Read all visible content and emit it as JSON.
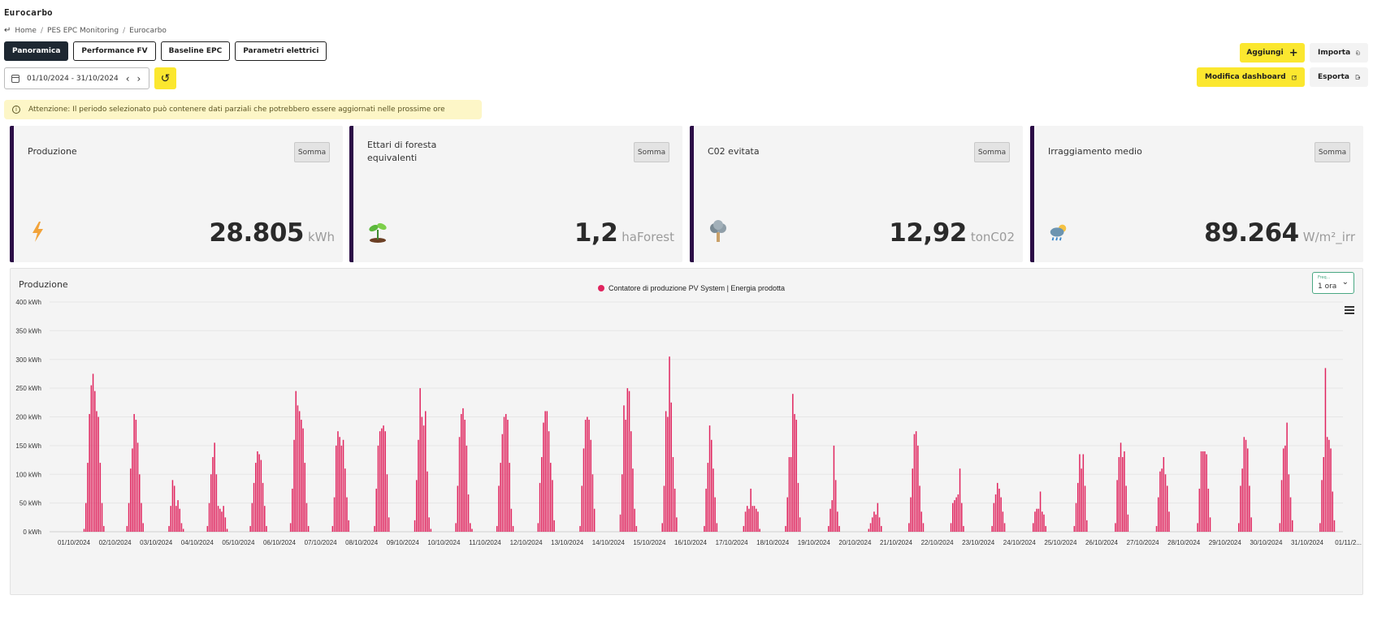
{
  "app": {
    "title": "Eurocarbo"
  },
  "breadcrumb": {
    "items": [
      "Home",
      "PES EPC Monitoring",
      "Eurocarbo"
    ]
  },
  "tabs": [
    {
      "label": "Panoramica",
      "active": true
    },
    {
      "label": "Performance FV",
      "active": false
    },
    {
      "label": "Baseline EPC",
      "active": false
    },
    {
      "label": "Parametri elettrici",
      "active": false
    }
  ],
  "toolbar": {
    "date_range": "01/10/2024 - 31/10/2024",
    "add_label": "Aggiungi",
    "import_label": "Importa",
    "edit_dashboard_label": "Modifica dashboard",
    "export_label": "Esporta"
  },
  "alert": {
    "text": "Attenzione: Il periodo selezionato può contenere dati parziali che potrebbero essere aggiornati nelle prossime ore"
  },
  "cards": [
    {
      "title": "Produzione",
      "aggregation": "Somma",
      "value": "28.805",
      "unit": "kWh",
      "icon": "lightning-icon"
    },
    {
      "title": "Ettari di foresta equivalenti",
      "aggregation": "Somma",
      "value": "1,2",
      "unit": "haForest",
      "icon": "sprout-icon"
    },
    {
      "title": "C02 evitata",
      "aggregation": "Somma",
      "value": "12,92",
      "unit": "tonC02",
      "icon": "tree-icon"
    },
    {
      "title": "Irraggiamento medio",
      "aggregation": "Somma",
      "value": "89.264",
      "unit": "W/m²_irr",
      "icon": "weather-icon"
    }
  ],
  "chart_panel": {
    "title": "Produzione",
    "frequency_label": "Freq...",
    "frequency_value": "1 ora"
  },
  "colors": {
    "accent": "#fbe72f",
    "card_border": "#2b0c46",
    "series": "#e0245e",
    "tab_active": "#1e2832"
  },
  "chart_data": {
    "type": "bar",
    "legend": "Contatore di produzione PV System | Energia prodotta",
    "ylabel_unit": "kWh",
    "ylim": [
      0,
      400
    ],
    "yticks": [
      "0 kWh",
      "50 kWh",
      "100 kWh",
      "150 kWh",
      "200 kWh",
      "250 kWh",
      "300 kWh",
      "350 kWh",
      "400 kWh"
    ],
    "xticks": [
      "01/10/2024",
      "02/10/2024",
      "03/10/2024",
      "04/10/2024",
      "05/10/2024",
      "06/10/2024",
      "07/10/2024",
      "08/10/2024",
      "09/10/2024",
      "10/10/2024",
      "11/10/2024",
      "12/10/2024",
      "13/10/2024",
      "14/10/2024",
      "15/10/2024",
      "16/10/2024",
      "17/10/2024",
      "18/10/2024",
      "19/10/2024",
      "20/10/2024",
      "21/10/2024",
      "22/10/2024",
      "23/10/2024",
      "24/10/2024",
      "25/10/2024",
      "26/10/2024",
      "27/10/2024",
      "28/10/2024",
      "29/10/2024",
      "30/10/2024",
      "31/10/2024",
      "01/11/2..."
    ],
    "grid": true,
    "legend_position": "top-center",
    "series": [
      {
        "name": "Contatore di produzione PV System | Energia prodotta",
        "hourly_daylight_values": [
          [
            5,
            50,
            120,
            205,
            255,
            275,
            245,
            210,
            200,
            120,
            50,
            10
          ],
          [
            10,
            50,
            110,
            145,
            205,
            195,
            155,
            100,
            50,
            15
          ],
          [
            10,
            45,
            90,
            80,
            45,
            55,
            40,
            15,
            5
          ],
          [
            10,
            50,
            100,
            130,
            155,
            100,
            45,
            40,
            35,
            45,
            25,
            5
          ],
          [
            10,
            50,
            85,
            120,
            140,
            135,
            125,
            85,
            45,
            10
          ],
          [
            15,
            75,
            160,
            245,
            220,
            210,
            195,
            180,
            120,
            50,
            10
          ],
          [
            10,
            60,
            150,
            175,
            165,
            150,
            160,
            110,
            60,
            20
          ],
          [
            10,
            75,
            150,
            175,
            180,
            185,
            175,
            100,
            25
          ],
          [
            20,
            90,
            160,
            250,
            200,
            185,
            210,
            105,
            25,
            5
          ],
          [
            15,
            80,
            165,
            205,
            215,
            195,
            150,
            65,
            15,
            5
          ],
          [
            10,
            80,
            120,
            170,
            200,
            205,
            195,
            120,
            40,
            10
          ],
          [
            15,
            85,
            130,
            190,
            210,
            210,
            175,
            120,
            90,
            20
          ],
          [
            10,
            80,
            145,
            195,
            200,
            195,
            160,
            100,
            40
          ],
          [
            30,
            100,
            220,
            195,
            250,
            245,
            175,
            110,
            40,
            10
          ],
          [
            15,
            80,
            210,
            200,
            305,
            225,
            130,
            75,
            25
          ],
          [
            10,
            75,
            120,
            185,
            160,
            110,
            60,
            15
          ],
          [
            10,
            35,
            45,
            40,
            75,
            45,
            45,
            40,
            35,
            5
          ],
          [
            10,
            60,
            130,
            130,
            240,
            205,
            195,
            85,
            25
          ],
          [
            10,
            40,
            55,
            150,
            90,
            35,
            10
          ],
          [
            5,
            15,
            25,
            35,
            30,
            50,
            25,
            10
          ],
          [
            15,
            60,
            110,
            170,
            175,
            150,
            80,
            35,
            15
          ],
          [
            15,
            50,
            55,
            60,
            65,
            110,
            50,
            10
          ],
          [
            10,
            50,
            65,
            85,
            75,
            60,
            35,
            15
          ],
          [
            15,
            35,
            40,
            40,
            70,
            35,
            30,
            10
          ],
          [
            10,
            50,
            85,
            135,
            110,
            135,
            80,
            20
          ],
          [
            15,
            90,
            130,
            155,
            130,
            140,
            80,
            30
          ],
          [
            10,
            60,
            105,
            110,
            130,
            100,
            80,
            35
          ],
          [
            15,
            75,
            140,
            140,
            140,
            135,
            75,
            25
          ],
          [
            15,
            80,
            110,
            165,
            160,
            145,
            80,
            25
          ],
          [
            15,
            90,
            145,
            150,
            190,
            100,
            60,
            20
          ],
          [
            15,
            90,
            130,
            285,
            165,
            160,
            145,
            70,
            20
          ]
        ]
      }
    ]
  }
}
